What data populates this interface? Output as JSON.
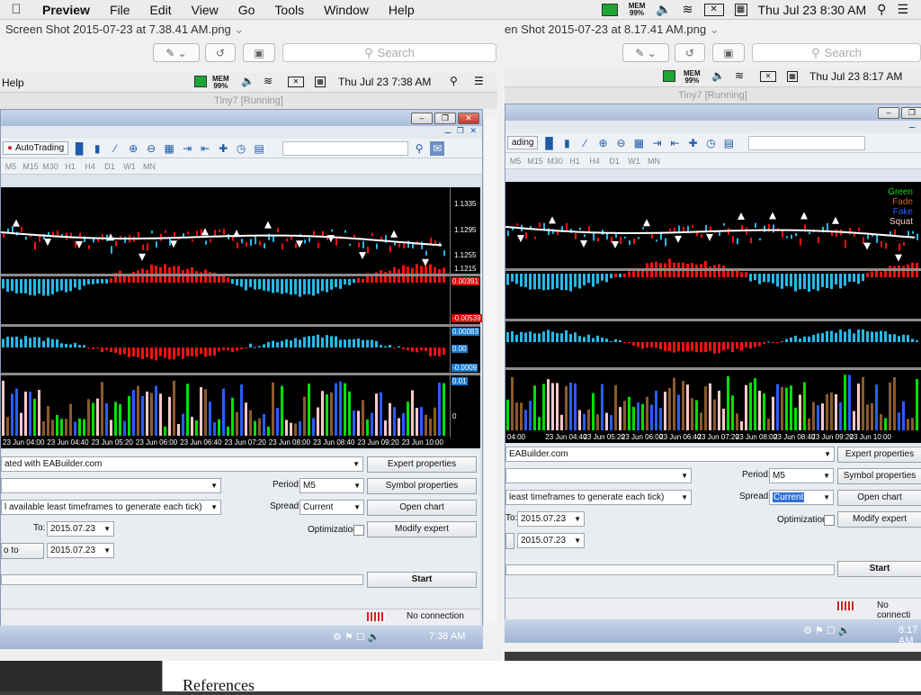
{
  "menubar": {
    "app": "Preview",
    "items": [
      "File",
      "Edit",
      "View",
      "Go",
      "Tools",
      "Window",
      "Help"
    ],
    "mem_label": "MEM",
    "mem_value": "99%",
    "clock": "Thu Jul 23  8:30 AM"
  },
  "left_window": {
    "title": "Screen Shot 2015-07-23 at 7.38.41 AM.png",
    "search_placeholder": "Search",
    "inner_menu": "Help",
    "inner_mem_label": "MEM",
    "inner_mem_value": "99%",
    "inner_clock": "Thu Jul 23  7:38 AM",
    "vm_title": "Tiny7 [Running]",
    "autotrading": "AutoTrading",
    "timeframes": [
      "M5",
      "M15",
      "M30",
      "H1",
      "H4",
      "D1",
      "W1",
      "MN"
    ],
    "price_ticks": [
      "1.1335",
      "1.1295",
      "1.1255",
      "1.1215"
    ],
    "osc1_ticks": [
      "0.00391",
      "-0.00539"
    ],
    "osc2_ticks": [
      "0.00083",
      "0.00",
      "-0.0009"
    ],
    "vol_ticks": [
      "0.01",
      "0"
    ],
    "time_ticks": [
      "23 Jun 04:00",
      "23 Jun 04:40",
      "23 Jun 05:20",
      "23 Jun 06:00",
      "23 Jun 06:40",
      "23 Jun 07:20",
      "23 Jun 08:00",
      "23 Jun 08:40",
      "23 Jun 09:20",
      "23 Jun 10:00"
    ],
    "expert": "ated with EABuilder.com",
    "model": "l available least timeframes to generate each tick)",
    "period_label": "Period:",
    "period_value": "M5",
    "spread_label": "Spread:",
    "spread_value": "Current",
    "to_label": "To:",
    "to_value": "2015.07.23",
    "upto_label": "o to",
    "upto_value": "2015.07.23",
    "optimization_label": "Optimization",
    "btn_expert": "Expert properties",
    "btn_symbol": "Symbol properties",
    "btn_open": "Open chart",
    "btn_modify": "Modify expert",
    "btn_start": "Start",
    "status": "No connection",
    "taskbar_time": "7:38 AM",
    "doc_text": "References"
  },
  "right_window": {
    "title": "en Shot 2015-07-23 at 8.17.41 AM.png",
    "search_placeholder": "Search",
    "inner_mem_label": "MEM",
    "inner_mem_value": "99%",
    "inner_clock": "Thu Jul 23  8:17 AM",
    "vm_title": "Tiny7 [Running]",
    "autotrading": "ading",
    "timeframes": [
      "M5",
      "M15",
      "M30",
      "H1",
      "H4",
      "D1",
      "W1",
      "MN"
    ],
    "legend": [
      {
        "label": "Green",
        "color": "#00e000"
      },
      {
        "label": "Fade",
        "color": "#c8641e"
      },
      {
        "label": "Fake",
        "color": "#2a5cff"
      },
      {
        "label": "Squat",
        "color": "#ffc8c8"
      }
    ],
    "time_ticks": [
      "04:00",
      "23 Jun 04:40",
      "23 Jun 05:20",
      "23 Jun 06:00",
      "23 Jun 06:40",
      "23 Jun 07:20",
      "23 Jun 08:00",
      "23 Jun 08:40",
      "23 Jun 09:20",
      "23 Jun 10:00"
    ],
    "expert": "EABuilder.com",
    "model": "least timeframes to generate each tick)",
    "period_label": "Period:",
    "period_value": "M5",
    "spread_label": "Spread:",
    "spread_value": "Current",
    "to_label": "To:",
    "to_value": "2015.07.23",
    "upto_value": "2015.07.23",
    "optimization_label": "Optimization",
    "btn_expert": "Expert properties",
    "btn_symbol": "Symbol properties",
    "btn_open": "Open chart",
    "btn_modify": "Modify expert",
    "btn_start": "Start",
    "status": "No connecti",
    "taskbar_time": "8:17 AM"
  },
  "colors": {
    "bull": "#27b8e8",
    "bear": "#ff1010",
    "ma": "#ffffff",
    "vol_green": "#00e000",
    "vol_brown": "#8b5a2b",
    "vol_blue": "#2a5cff",
    "vol_pink": "#ffc8c8"
  }
}
